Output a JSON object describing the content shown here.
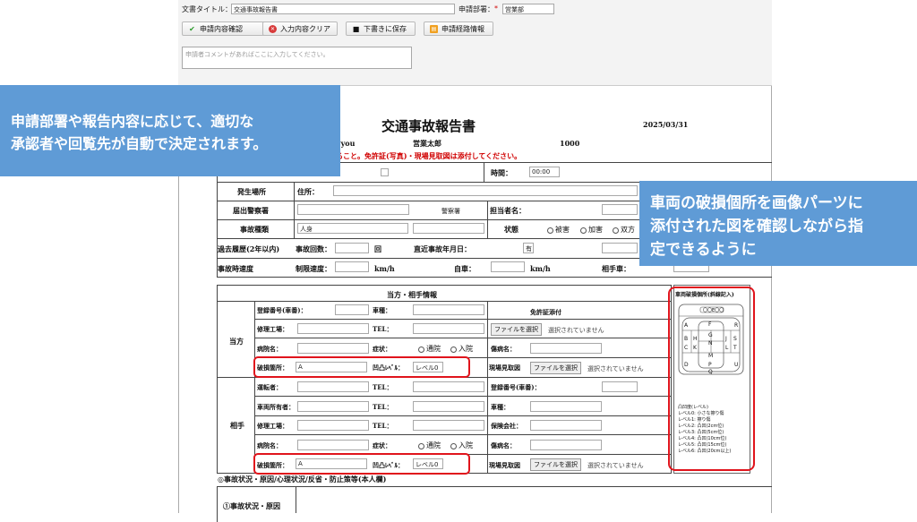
{
  "toolbar": {
    "doc_title_label": "文書タイトル：",
    "doc_title_value": "交通事故報告書",
    "dept_label": "申請部署：",
    "dept_required": "*",
    "dept_value": "営業部",
    "confirm_label": "申請内容確認",
    "clear_label": "入力内容クリア",
    "save_label": "下書きに保存",
    "route_label": "申請経路情報",
    "comment_placeholder": "申請者コメントがあればここに入力してください。"
  },
  "report": {
    "title": "交通事故報告書",
    "date": "2025/03/31",
    "applicant_fragment": "gyou",
    "applicant_name": "営業太郎",
    "applicant_no": "1000",
    "notice": "ること。免許証(写真)・現場見取図は添付してください。",
    "time_label": "時間：",
    "time_hh": "00",
    "time_mm": "00",
    "place_label": "発生場所",
    "address_label": "住所：",
    "police_label": "届出警察署",
    "police_suffix": "警察署",
    "person_label": "担当者名：",
    "type_label": "事故種類",
    "type_value": "人身",
    "status_label": "状態",
    "status_options": [
      "被害",
      "加害",
      "双方"
    ],
    "history_label": "過去履歴(2年以内)",
    "count_label": "事故回数：",
    "count_unit": "回",
    "recent_label": "直近事故年月日：",
    "recent_value": "有",
    "speed_label": "事故時速度",
    "limit_label": "制限速度：",
    "kmh_1": "km/h",
    "own_car_label": "自車：",
    "kmh_2": "km/h",
    "other_car_label": "相手車："
  },
  "parties": {
    "header": "当方・相手情報",
    "own_label": "当方",
    "other_label": "相手",
    "license_header": "免許証添付",
    "reg_no": "登録番号(車番)：",
    "car_type": "車種：",
    "repair_shop": "修理工場：",
    "tel": "TEL：",
    "hospital": "病院名：",
    "symptom": "症状：",
    "visit": "通院",
    "admit": "入院",
    "disease": "傷病名：",
    "damage": "破損箇所：",
    "damage_value": "A",
    "dent": "凹凸ﾚﾍﾞﾙ：",
    "dent_value": "レベル0",
    "sketch": "現場見取図",
    "file_button": "ファイルを選択",
    "file_none": "選択されていません",
    "driver": "運転者：",
    "owner": "車両所有者：",
    "insurer": "保険会社：",
    "damage_value_2": "A",
    "dent_value_2": "レベル0"
  },
  "diagram": {
    "title": "車両破損個所(斜線記入)",
    "top_label": "〇〇E〇〇",
    "letters": [
      "A",
      "F",
      "R",
      "G",
      "B",
      "H",
      "N",
      "J",
      "S",
      "C",
      "K",
      "L",
      "T",
      "M",
      "D",
      "P",
      "U",
      "Q"
    ],
    "legend": [
      "凸凹度(レベル)",
      "レベル0: 小さな擦り傷",
      "レベル1: 擦り傷",
      "レベル2: 凸凹(2cm位)",
      "レベル3: 凸凹(5cm位)",
      "レベル4: 凸凹(10cm位)",
      "レベル5: 凸凹(15cm位)",
      "レベル6: 凸凹(20cm以上)"
    ]
  },
  "section": {
    "heading": "◎事故状況・原因/心理状況/反省・防止策等(本人欄)",
    "cause_label": "①事故状況・原因"
  },
  "callouts": {
    "left_line1": "申請部署や報告内容に応じて、適切な",
    "left_line2": "承認者や回覧先が自動で決定されます。",
    "right_line1": "車両の破損個所を画像パーツに",
    "right_line2": "添付された図を確認しながら指",
    "right_line3": "定できるように"
  },
  "colors": {
    "callout_bg": "#5f9bd6",
    "highlight_red": "#e0141c",
    "required_red": "#d00000"
  }
}
